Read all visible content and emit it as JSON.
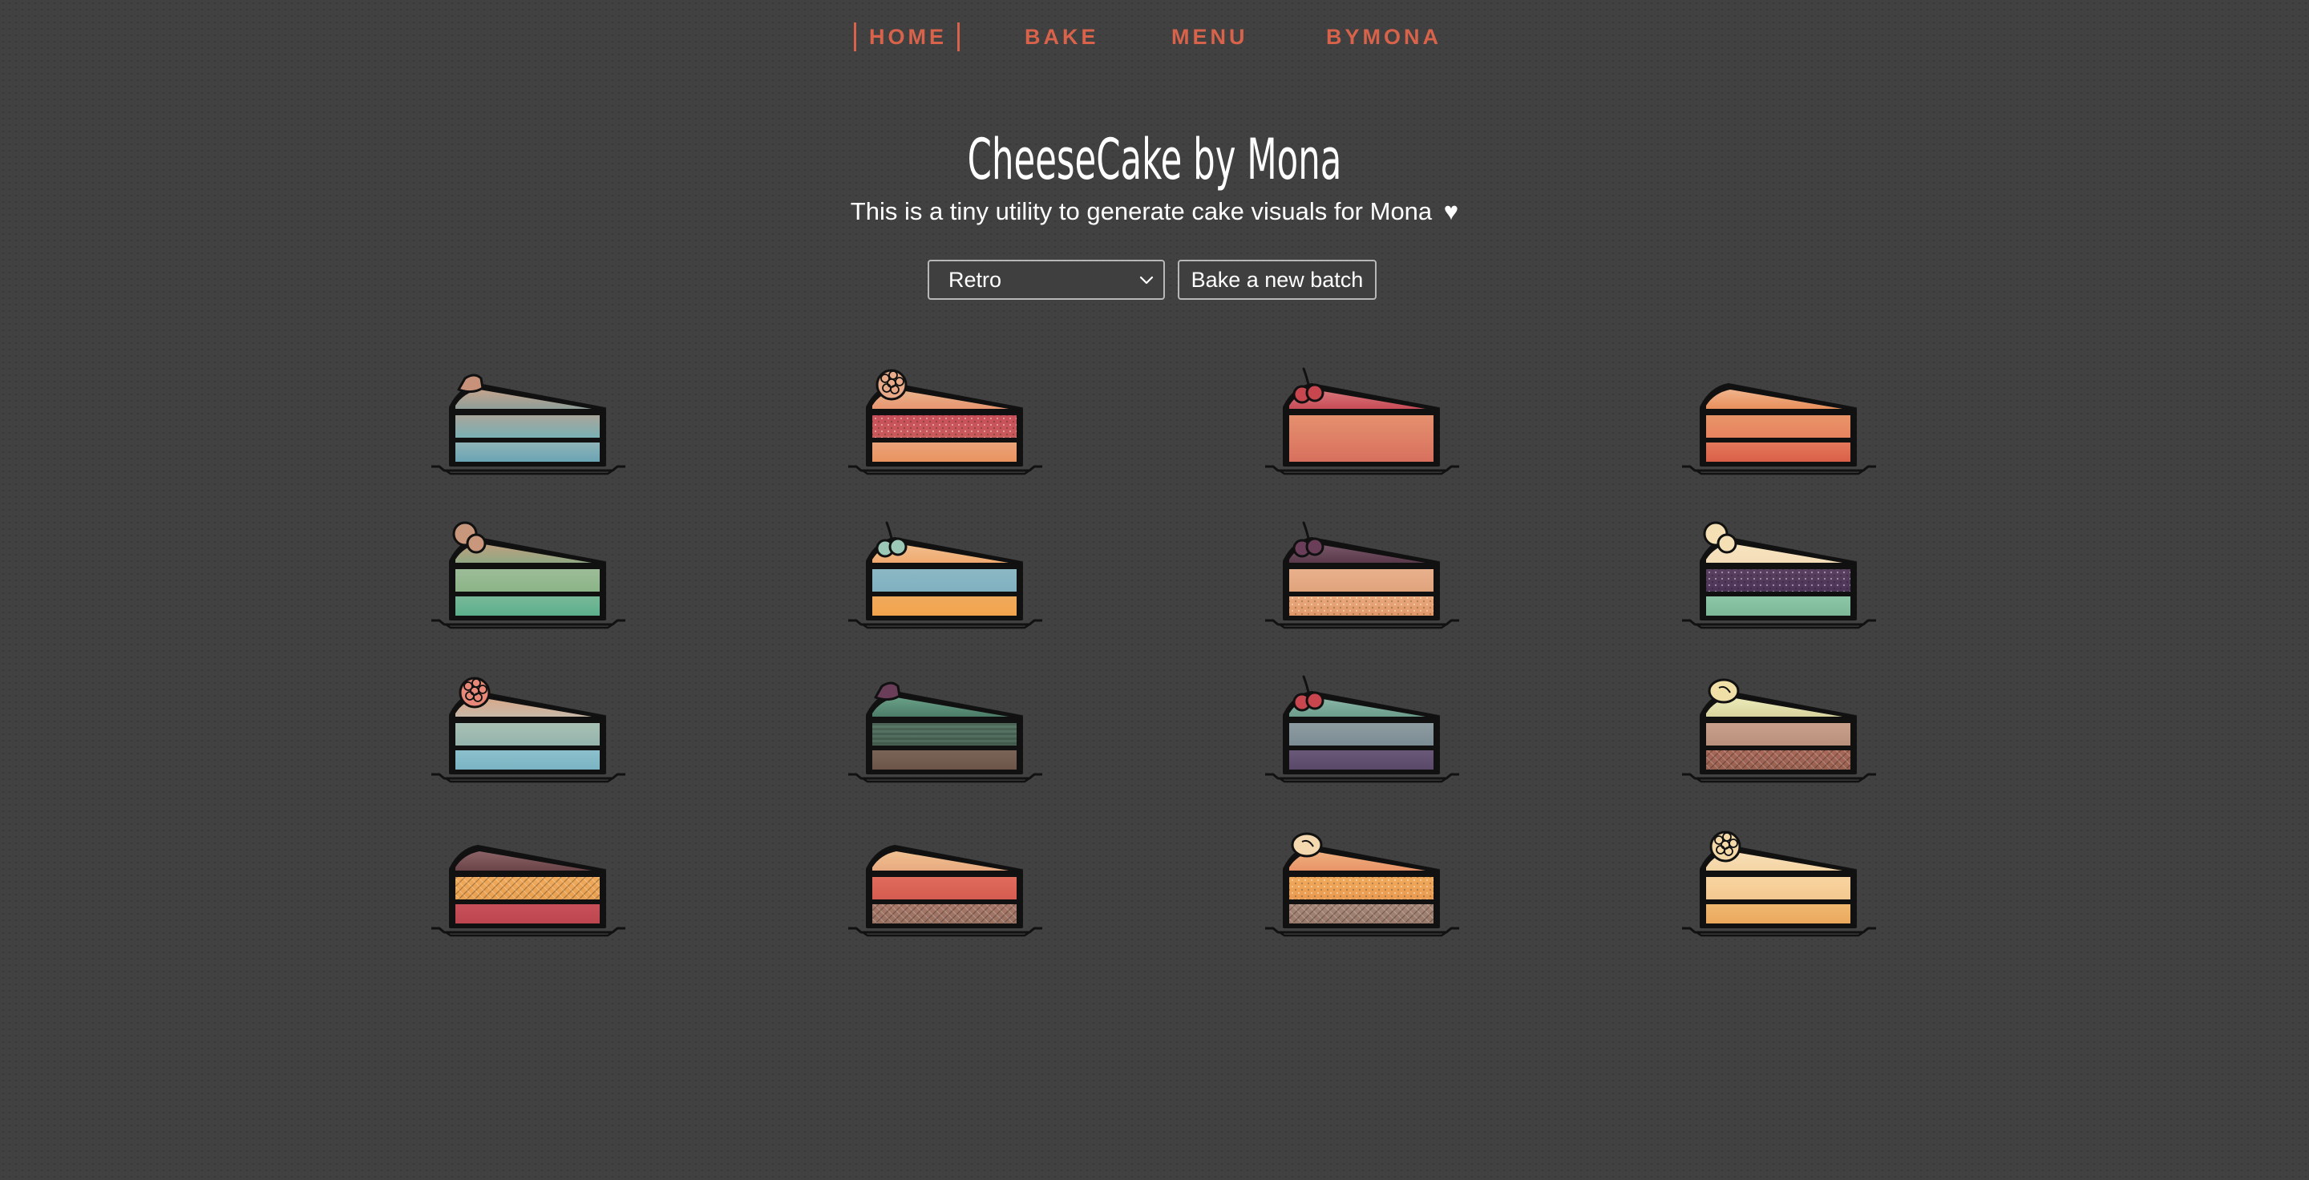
{
  "nav": {
    "items": [
      {
        "label": "HOME",
        "active": true
      },
      {
        "label": "BAKE",
        "active": false
      },
      {
        "label": "MENU",
        "active": false
      },
      {
        "label": "BYMONA",
        "active": false
      }
    ]
  },
  "header": {
    "title": "CheeseCake by Mona",
    "subtitle": "This is a tiny utility to generate cake visuals for Mona",
    "heart": "♥"
  },
  "controls": {
    "theme_value": "Retro",
    "bake_label": "Bake a new batch"
  },
  "colors": {
    "background": "#414141",
    "accent": "#d8634a",
    "outline": "#111111"
  },
  "cakes": [
    {
      "top": [
        "#c4a48d",
        "#8f9f9a"
      ],
      "layers": [
        [
          "#a9a59b",
          "#7ab0b4",
          "plain"
        ],
        [
          "#8fb4b8",
          "#6aa4b4",
          "plain"
        ]
      ],
      "topping": "chocolate",
      "topping_color": "#c8927a"
    },
    {
      "top": [
        "#e8b48c",
        "#e89670"
      ],
      "layers": [
        [
          "#c8505a",
          "#c85a5a",
          "dots"
        ],
        [
          "#eaa37a",
          "#e9935f",
          "plain"
        ]
      ],
      "topping": "raspberry",
      "topping_color": "#e8aa88"
    },
    {
      "top": [
        "#d8787c",
        "#c84c58"
      ],
      "layers": [
        [
          "#e5906e",
          "#d7705e",
          "plain"
        ],
        null
      ],
      "topping": "cherry",
      "topping_color": "#c8464e"
    },
    {
      "top": [
        "#f0b48c",
        "#e8905c"
      ],
      "layers": [
        [
          "#e89468",
          "#e88360",
          "plain"
        ],
        [
          "#e4785a",
          "#da6048",
          "plain"
        ]
      ],
      "topping": "none",
      "topping_color": ""
    },
    {
      "top": [
        "#c0a080",
        "#90a882"
      ],
      "layers": [
        [
          "#9cbc98",
          "#8cb488",
          "plain"
        ],
        [
          "#78b898",
          "#5cb08c",
          "plain"
        ]
      ],
      "topping": "balls",
      "topping_color": "#c8977c"
    },
    {
      "top": [
        "#f0c090",
        "#f0aa70"
      ],
      "layers": [
        [
          "#8cb8c4",
          "#80b0c0",
          "plain"
        ],
        [
          "#f0aa5c",
          "#f2a44c",
          "plain"
        ]
      ],
      "topping": "cherry",
      "topping_color": "#9cc8b8"
    },
    {
      "top": [
        "#7a5a6a",
        "#5a3a4a"
      ],
      "layers": [
        [
          "#e8b08c",
          "#e0a47c",
          "plain"
        ],
        [
          "#eaa87c",
          "#e09868",
          "dots"
        ]
      ],
      "topping": "cherry",
      "topping_color": "#6a3e58"
    },
    {
      "top": [
        "#f8e4c0",
        "#f4dcb8"
      ],
      "layers": [
        [
          "#5a4060",
          "#4a3456",
          "dots"
        ],
        [
          "#8cc8a8",
          "#7cb898",
          "plain"
        ]
      ],
      "topping": "balls",
      "topping_color": "#f4e0b4"
    },
    {
      "top": [
        "#d8a888",
        "#c8b8a8"
      ],
      "layers": [
        [
          "#a8c0b4",
          "#94b4ac",
          "plain"
        ],
        [
          "#8cc0cc",
          "#7ab4c4",
          "plain"
        ]
      ],
      "topping": "raspberry",
      "topping_color": "#e88878"
    },
    {
      "top": [
        "#6aa088",
        "#4c7c68"
      ],
      "layers": [
        [
          "#5a7868",
          "#4c6858",
          "stripes"
        ],
        [
          "#7a6458",
          "#6c5448",
          "plain"
        ]
      ],
      "topping": "chocolate",
      "topping_color": "#6a3e58"
    },
    {
      "top": [
        "#8cb8a8",
        "#6c9c8c"
      ],
      "layers": [
        [
          "#8c9ca0",
          "#7c8c94",
          "plain"
        ],
        [
          "#6a5878",
          "#5a4868",
          "plain"
        ]
      ],
      "topping": "cherry",
      "topping_color": "#c8464e"
    },
    {
      "top": [
        "#ecebb8",
        "#d8d4a0"
      ],
      "layers": [
        [
          "#c8a08c",
          "#b8907c",
          "plain"
        ],
        [
          "#a86858",
          "#986050",
          "hatch"
        ]
      ],
      "topping": "banana",
      "topping_color": "#f0e0a8"
    },
    {
      "top": [
        "#8c6468",
        "#6a4448"
      ],
      "layers": [
        [
          "#f0aa5c",
          "#e8a050",
          "hatch"
        ],
        [
          "#c8505a",
          "#bc4650",
          "plain"
        ]
      ],
      "topping": "none",
      "topping_color": ""
    },
    {
      "top": [
        "#f0c090",
        "#e8aa80"
      ],
      "layers": [
        [
          "#e06c5c",
          "#d45c50",
          "plain"
        ],
        [
          "#a87868",
          "#987060",
          "hatch"
        ]
      ],
      "topping": "none",
      "topping_color": ""
    },
    {
      "top": [
        "#f0b080",
        "#e89468"
      ],
      "layers": [
        [
          "#f0aa5c",
          "#e89a50",
          "dots"
        ],
        [
          "#a88878",
          "#987868",
          "hatch"
        ]
      ],
      "topping": "banana",
      "topping_color": "#f4d8b0"
    },
    {
      "top": [
        "#f8e0b8",
        "#f4d4a4"
      ],
      "layers": [
        [
          "#f8d4a0",
          "#f4c890",
          "plain"
        ],
        [
          "#f0b870",
          "#eaa85c",
          "plain"
        ]
      ],
      "topping": "raspberry",
      "topping_color": "#f4d8a8"
    }
  ]
}
